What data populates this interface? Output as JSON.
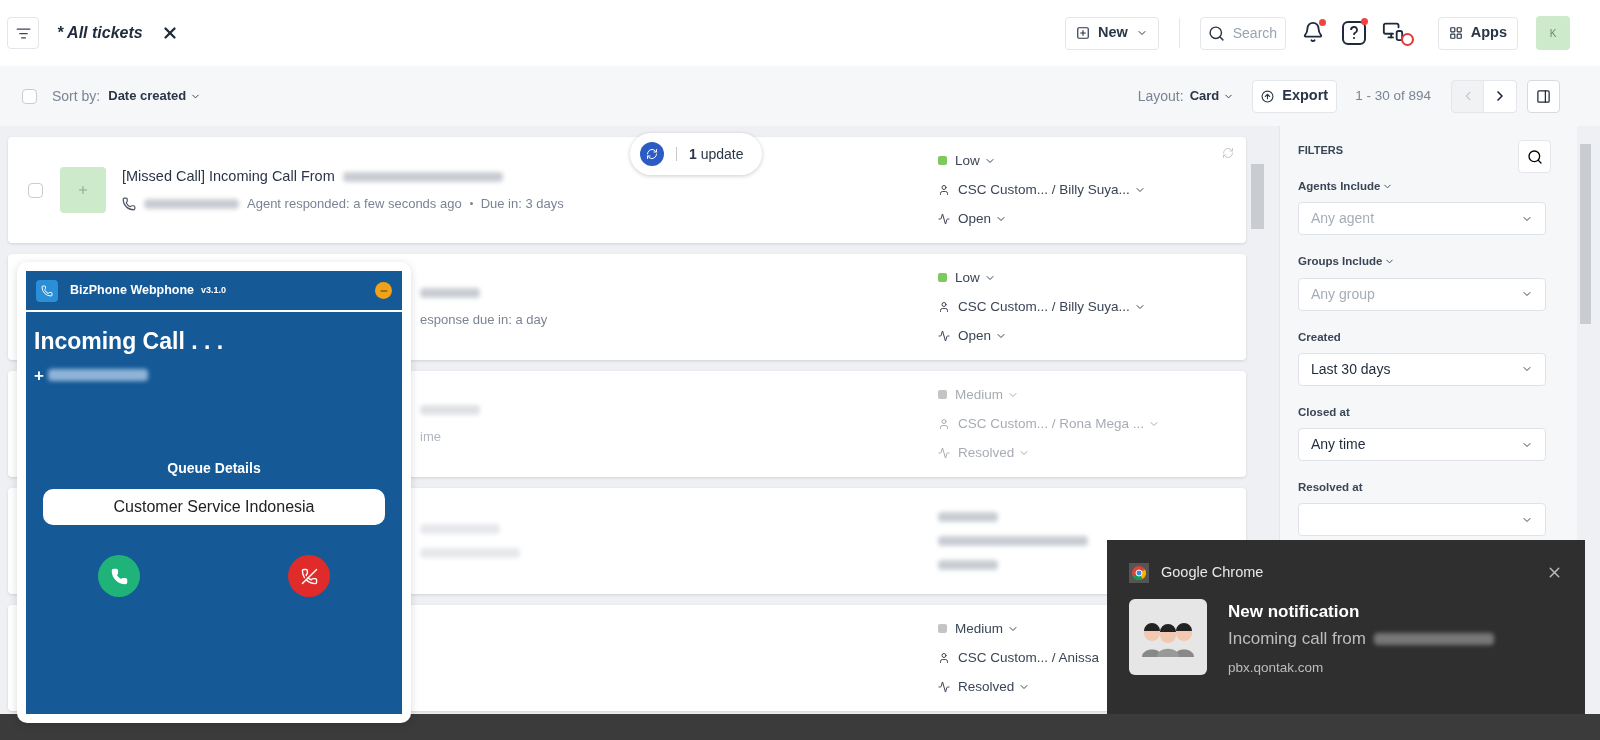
{
  "header": {
    "view_title": "* All tickets",
    "new_button": "New",
    "search": {
      "placeholder": "Search"
    },
    "notifications_unread": true,
    "help_unread": true,
    "apps_button": "Apps",
    "avatar": "K"
  },
  "toolbar": {
    "select_all_checked": false,
    "sort_label": "Sort by:",
    "sort_value": "Date created",
    "layout_label": "Layout:",
    "layout_value": "Card",
    "export_button": "Export",
    "pagination": "1 - 30 of 894",
    "prev_disabled": true
  },
  "update_pill": {
    "count": "1",
    "label": "update"
  },
  "tickets": [
    {
      "kind": "full",
      "checked": false,
      "faded": false,
      "title": "[Missed Call] Incoming Call From",
      "meta": "Agent responded: a few seconds ago",
      "due": "Due in: 3 days",
      "priority": "Low",
      "color": "#7dc95e",
      "assignee": "CSC Custom... / Billy Suya...",
      "status": "Open"
    },
    {
      "kind": "partial",
      "faded": false,
      "meta": "esponse due in: a day",
      "priority": "Low",
      "color": "#7dc95e",
      "assignee": "CSC Custom... / Billy Suya...",
      "status": "Open"
    },
    {
      "kind": "partial",
      "faded": true,
      "meta": "ime",
      "priority": "Medium",
      "color": "#c4c4c4",
      "assignee": "CSC Custom... / Rona Mega ...",
      "status": "Resolved"
    },
    {
      "kind": "blurred",
      "faded": true
    },
    {
      "kind": "right",
      "faded": false,
      "priority": "Medium",
      "color": "#c4c4c4",
      "assignee": "CSC Custom... / Anissa",
      "status": "Resolved"
    }
  ],
  "filters": {
    "title": "FILTERS",
    "fields": [
      {
        "label": "Agents Include",
        "label_menu": true,
        "placeholder": "Any agent"
      },
      {
        "label": "Groups Include",
        "label_menu": true,
        "placeholder": "Any group"
      },
      {
        "label": "Created",
        "label_menu": false,
        "value": "Last 30 days"
      },
      {
        "label": "Closed at",
        "label_menu": false,
        "value": "Any time"
      },
      {
        "label": "Resolved at",
        "label_menu": false
      }
    ]
  },
  "webphone": {
    "title": "BizPhone Webphone",
    "version": "v3.1.0",
    "heading": "Incoming Call . . .",
    "caller_prefix": "+",
    "queue_label": "Queue Details",
    "queue": "Customer Service Indonesia"
  },
  "notification": {
    "app": "Google Chrome",
    "title": "New notification",
    "body": "Incoming call from",
    "source": "pbx.qontak.com"
  }
}
